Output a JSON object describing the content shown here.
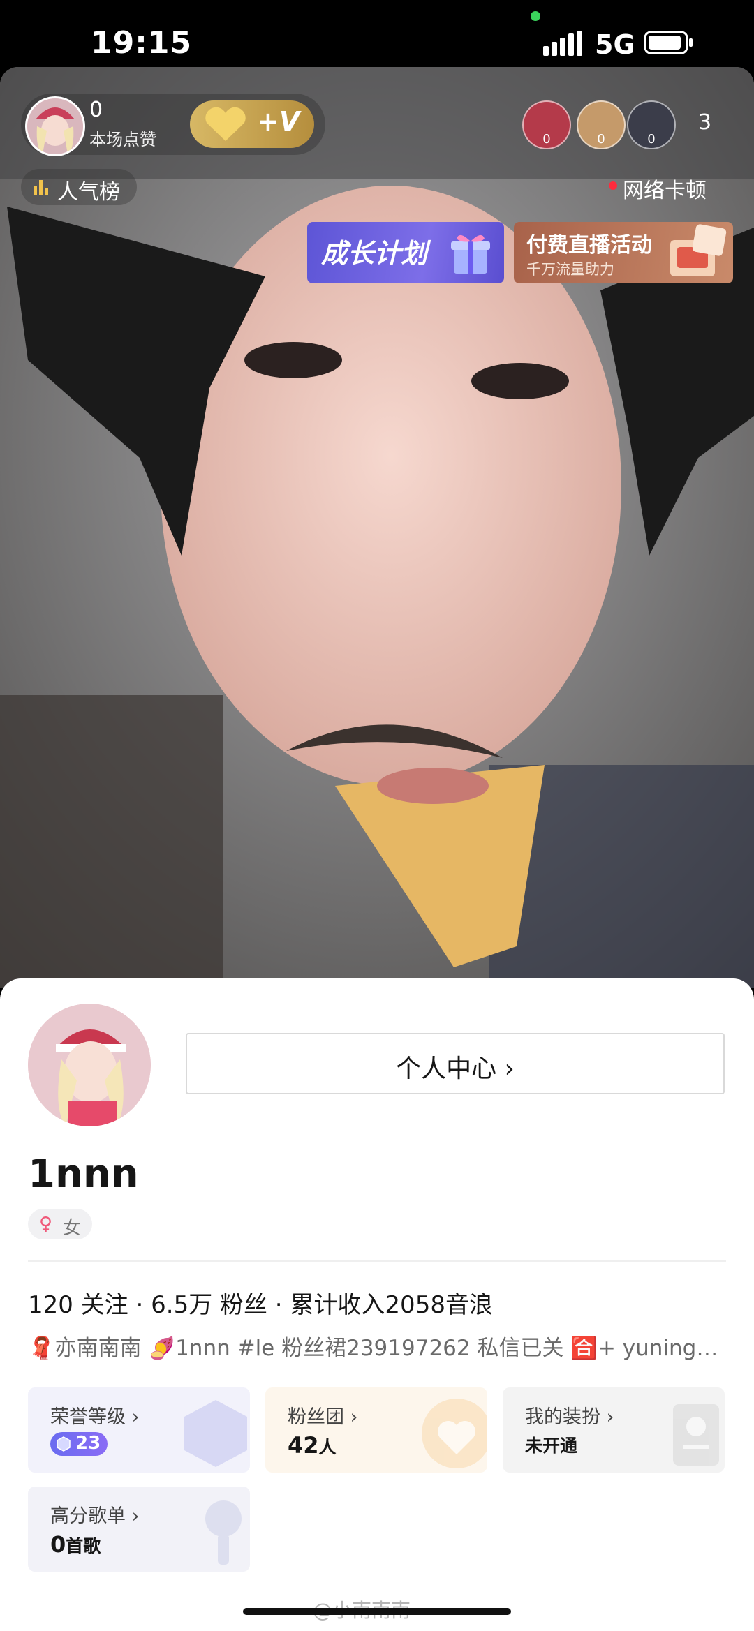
{
  "status_bar": {
    "time": "19:15",
    "network": "5G"
  },
  "live_room": {
    "host": {
      "likes_count": "0",
      "likes_label": "本场点赞",
      "follow_label": "+V"
    },
    "viewers": [
      {
        "badge": "0",
        "color": "#b43a4a"
      },
      {
        "badge": "0",
        "color": "#c59a6a"
      },
      {
        "badge": "0",
        "color": "#3b3d4a"
      }
    ],
    "viewer_count": "3",
    "rank_label": "人气榜",
    "network_status": "网络卡顿",
    "banners": {
      "growth": "成长计划",
      "paid_title": "付费直播活动",
      "paid_subtitle": "千万流量助力"
    }
  },
  "profile": {
    "center_button": "个人中心 ›",
    "username": "1nnn",
    "gender": "女",
    "stats": "120 关注 · 6.5万 粉丝 · 累计收入2058音浪",
    "bio": {
      "part1": "亦南南南",
      "part2": "1nnn #le 粉丝裙239197262 私信已关",
      "part3": "+ yuning…"
    },
    "cards": [
      {
        "label": "荣誉等级 ›",
        "level": "23"
      },
      {
        "label": "粉丝团 ›",
        "value_num": "42",
        "value_unit": "人"
      },
      {
        "label": "我的装扮 ›",
        "value": "未开通"
      },
      {
        "label": "高分歌单 ›",
        "value_num": "0",
        "value_unit": "首歌"
      }
    ]
  },
  "watermark": "@小南南南"
}
